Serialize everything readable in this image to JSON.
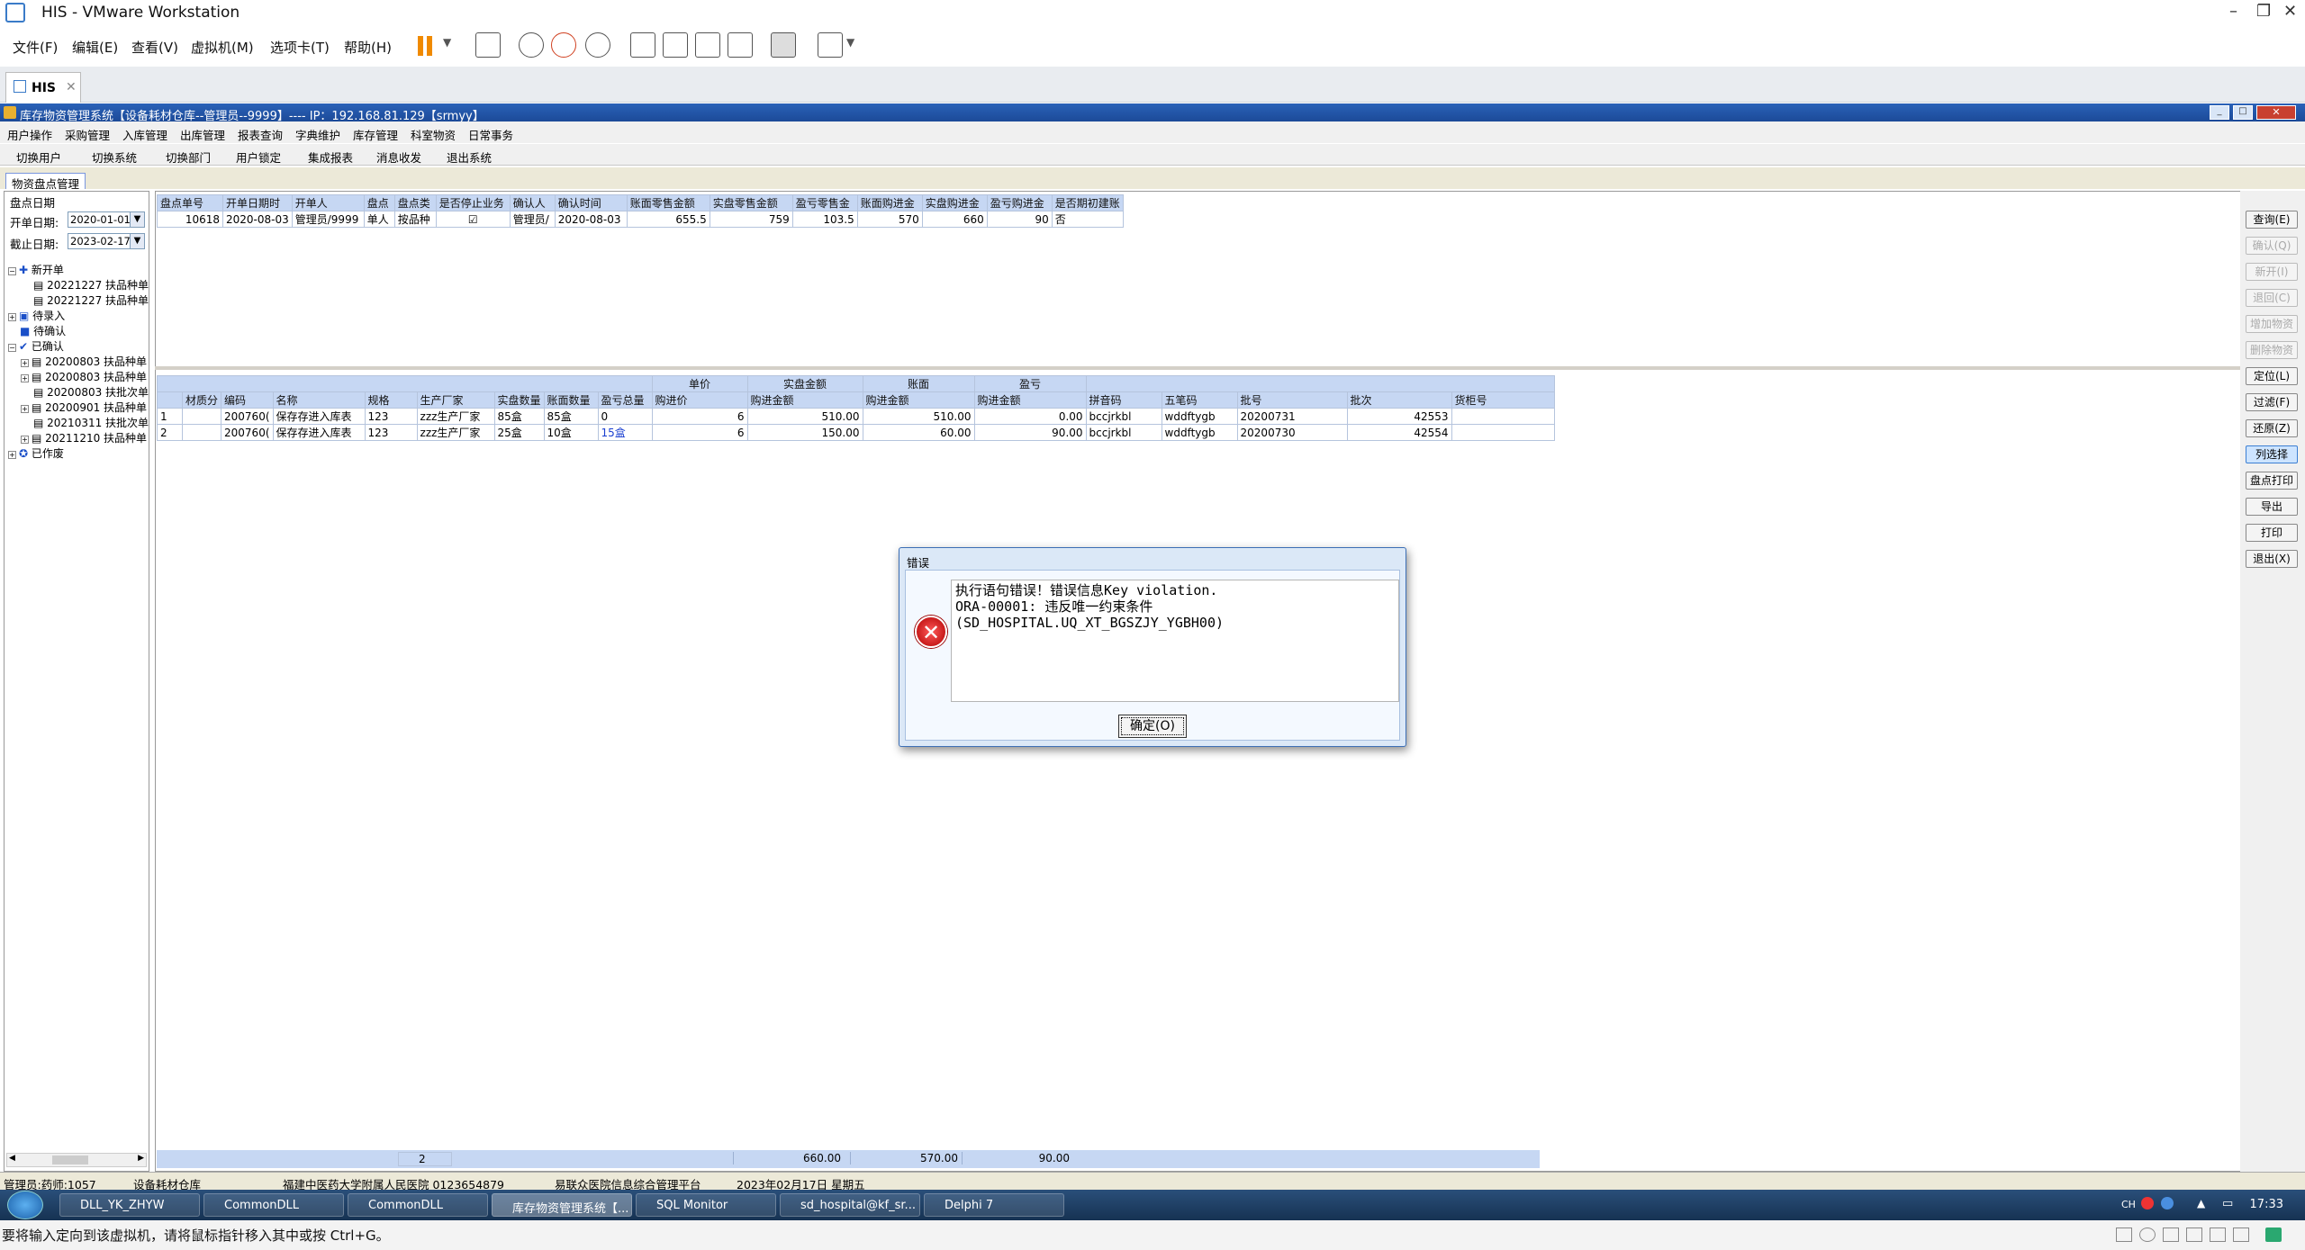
{
  "vm": {
    "title": "HIS - VMware Workstation",
    "menu": [
      "文件(F)",
      "编辑(E)",
      "查看(V)",
      "虚拟机(M)",
      "选项卡(T)",
      "帮助(H)"
    ],
    "tab": "HIS",
    "hint": "要将输入定向到该虚拟机，请将鼠标指针移入其中或按 Ctrl+G。"
  },
  "app": {
    "title": "库存物资管理系统【设备耗材仓库--管理员--9999】---- IP：192.168.81.129【srmyy】",
    "menu": [
      "用户操作",
      "采购管理",
      "入库管理",
      "出库管理",
      "报表查询",
      "字典维护",
      "库存管理",
      "科室物资",
      "日常事务"
    ],
    "tools": [
      "切换用户",
      "切换系统",
      "切换部门",
      "用户锁定",
      "集成报表",
      "消息收发",
      "退出系统"
    ],
    "tab": "物资盘点管理"
  },
  "left": {
    "group": "盘点日期",
    "start_label": "开单日期:",
    "start_value": "2020-01-01",
    "end_label": "截止日期:",
    "end_value": "2023-02-17",
    "tree": {
      "new": "新开单",
      "new_items": [
        "20221227 扶品种单",
        "20221227 扶品种单"
      ],
      "pending_entry": "待录入",
      "pending_confirm": "待确认",
      "confirmed": "已确认",
      "confirmed_items": [
        "20200803 扶品种单",
        "20200803 扶品种单",
        "20200803 扶批次单",
        "20200901 扶品种单",
        "20210311 扶批次单",
        "20211210 扶品种单"
      ],
      "voided": "已作废"
    }
  },
  "top_grid": {
    "headers": [
      "盘点单号",
      "开单日期时",
      "开单人",
      "盘点",
      "盘点类",
      "是否停止业务",
      "确认人",
      "确认时间",
      "账面零售金额",
      "实盘零售金额",
      "盈亏零售金",
      "账面购进金",
      "实盘购进金",
      "盈亏购进金",
      "是否期初建账"
    ],
    "rows": [
      [
        "10618",
        "2020-08-03",
        "管理员/9999",
        "单人",
        "按品种",
        "☑",
        "管理员/",
        "2020-08-03",
        "655.5",
        "759",
        "103.5",
        "570",
        "660",
        "90",
        "否"
      ]
    ]
  },
  "detail_grid": {
    "group_headers": {
      "unit_price": "单价",
      "actual_amount": "实盘金额",
      "book": "账面",
      "profit_loss": "盈亏"
    },
    "headers": [
      "",
      "材质分",
      "编码",
      "名称",
      "规格",
      "生产厂家",
      "实盘数量",
      "账面数量",
      "盈亏总量",
      "购进价",
      "购进金额",
      "购进金额",
      "购进金额",
      "拼音码",
      "五笔码",
      "批号",
      "批次",
      "货柜号"
    ],
    "rows": [
      [
        "1",
        "",
        "200760(",
        "保存存进入库表",
        "123",
        "zzz生产厂家",
        "85盒",
        "85盒",
        "0",
        "6",
        "510.00",
        "510.00",
        "0.00",
        "bccjrkbl",
        "wddftygb",
        "20200731",
        "42553",
        ""
      ],
      [
        "2",
        "",
        "200760(",
        "保存存进入库表",
        "123",
        "zzz生产厂家",
        "25盒",
        "10盒",
        "15盒",
        "6",
        "150.00",
        "60.00",
        "90.00",
        "bccjrkbl",
        "wddftygb",
        "20200730",
        "42554",
        ""
      ]
    ],
    "summary": {
      "count": "2",
      "actual": "660.00",
      "book": "570.00",
      "profit": "90.00"
    }
  },
  "right_buttons": [
    {
      "label": "查询(E)",
      "enabled": true
    },
    {
      "label": "确认(Q)",
      "enabled": false
    },
    {
      "label": "新开(I)",
      "enabled": false
    },
    {
      "label": "退回(C)",
      "enabled": false
    },
    {
      "label": "增加物资",
      "enabled": false
    },
    {
      "label": "删除物资",
      "enabled": false
    },
    {
      "label": "定位(L)",
      "enabled": true
    },
    {
      "label": "过滤(F)",
      "enabled": true
    },
    {
      "label": "还原(Z)",
      "enabled": true
    },
    {
      "label": "列选择",
      "enabled": true,
      "selected": true
    },
    {
      "label": "盘点打印",
      "enabled": true
    },
    {
      "label": "导出",
      "enabled": true
    },
    {
      "label": "打印",
      "enabled": true
    },
    {
      "label": "退出(X)",
      "enabled": true
    }
  ],
  "status": [
    "管理员:药师:1057",
    "设备耗材仓库",
    "福建中医药大学附属人民医院 0123654879",
    "易联众医院信息综合管理平台",
    "2023年02月17日 星期五"
  ],
  "taskbar": {
    "items": [
      "DLL_YK_ZHYW",
      "CommonDLL",
      "CommonDLL",
      "库存物资管理系统【...",
      "SQL Monitor",
      "sd_hospital@kf_sr...",
      "Delphi 7"
    ],
    "active_index": 3,
    "tray_lang": "CH",
    "time": "17:33"
  },
  "dialog": {
    "title": "错误",
    "message": "执行语句错误！错误信息Key violation.\nORA-00001: 违反唯一约束条件\n(SD_HOSPITAL.UQ_XT_BGSZJY_YGBH00)",
    "ok": "确定(O)"
  },
  "colors": {
    "app_title": "#1c4a98",
    "grid_header": "#c6d7f3",
    "dialog_bg": "#dbe8f7",
    "error_red": "#d00000"
  }
}
